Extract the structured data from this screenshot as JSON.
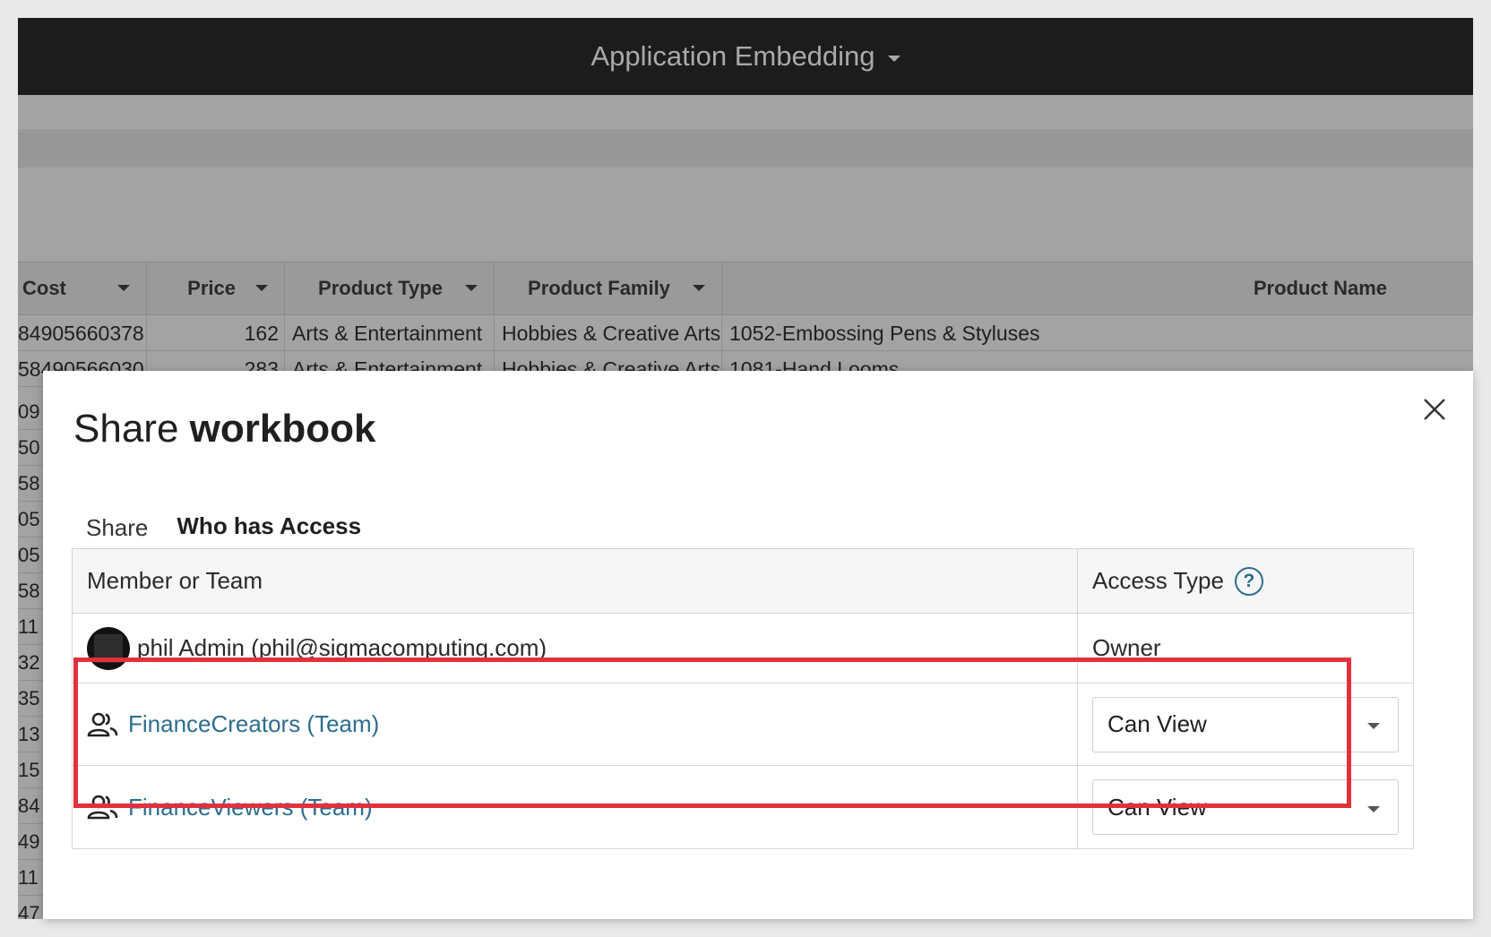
{
  "app": {
    "title": "Application Embedding"
  },
  "grid": {
    "columns": [
      "Cost",
      "Price",
      "Product Type",
      "Product Family",
      "Product Name"
    ],
    "rows": [
      {
        "cost": "84905660378",
        "price": "162",
        "type": "Arts & Entertainment",
        "family": "Hobbies & Creative Arts",
        "name": "1052-Embossing Pens & Styluses"
      },
      {
        "cost": "58490566030",
        "price": "283",
        "type": "Arts & Entertainment",
        "family": "Hobbies & Creative Arts",
        "name": "1081-Hand Looms"
      }
    ],
    "side_numbers": [
      "09",
      "50",
      "58",
      "05",
      "05",
      "58",
      "11",
      "32",
      "35",
      "13",
      "15",
      "84",
      "49",
      "11",
      "47"
    ]
  },
  "modal": {
    "title_light": "Share",
    "title_bold": "workbook",
    "tabs": [
      "Share",
      "Who has Access"
    ],
    "active_tab": "Who has Access",
    "headers": {
      "member": "Member or Team",
      "access": "Access Type",
      "help_glyph": "?"
    },
    "entries": [
      {
        "name": "phil Admin (phil@sigmacomputing.com)",
        "access": "Owner",
        "kind": "user",
        "icon": "avatar"
      },
      {
        "name": "FinanceCreators (Team)",
        "access": "Can View",
        "kind": "team",
        "icon": "team-icon"
      },
      {
        "name": "FinanceViewers (Team)",
        "access": "Can View",
        "kind": "team",
        "icon": "team-icon"
      }
    ]
  },
  "colors": {
    "accent": "#2c6d8e",
    "highlight": "#e2303c",
    "topbar": "#1c1c1c"
  }
}
